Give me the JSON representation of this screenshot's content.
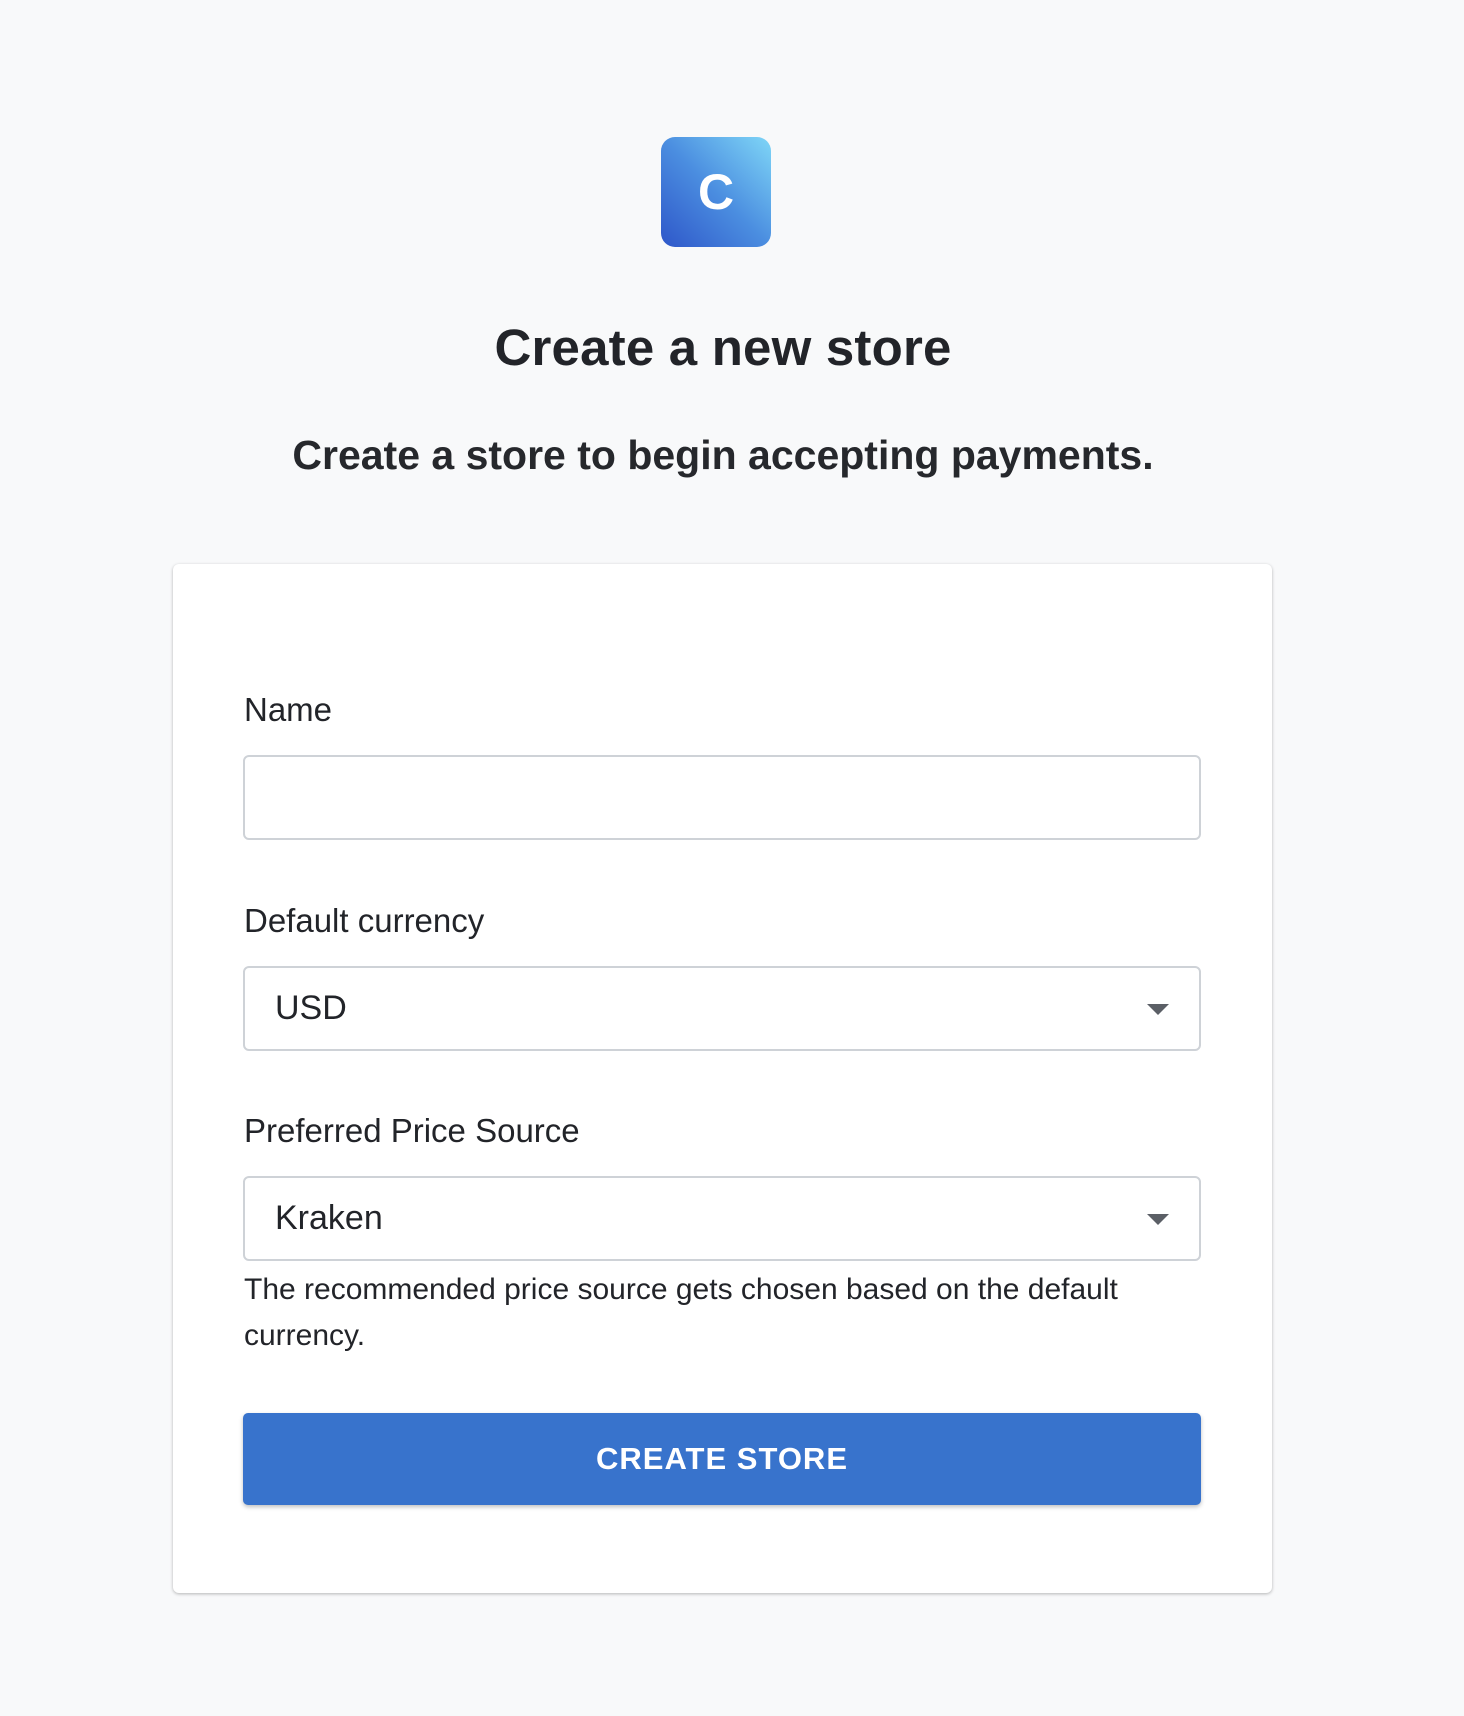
{
  "brand": {
    "logo_letter": "C",
    "gradient_colors": [
      "#2e57c9",
      "#7fd6f7"
    ]
  },
  "page": {
    "title": "Create a new store",
    "subtitle": "Create a store to begin accepting payments."
  },
  "form": {
    "name": {
      "label": "Name",
      "value": ""
    },
    "default_currency": {
      "label": "Default currency",
      "value": "USD"
    },
    "price_source": {
      "label": "Preferred Price Source",
      "value": "Kraken",
      "help": "The recommended price source gets chosen based on the default currency."
    },
    "submit_label": "CREATE STORE"
  },
  "colors": {
    "background": "#f8f9fa",
    "primary_button": "#3873cc"
  },
  "icons": {
    "logo": "brand-logo",
    "dropdown": "chevron-down-icon"
  }
}
